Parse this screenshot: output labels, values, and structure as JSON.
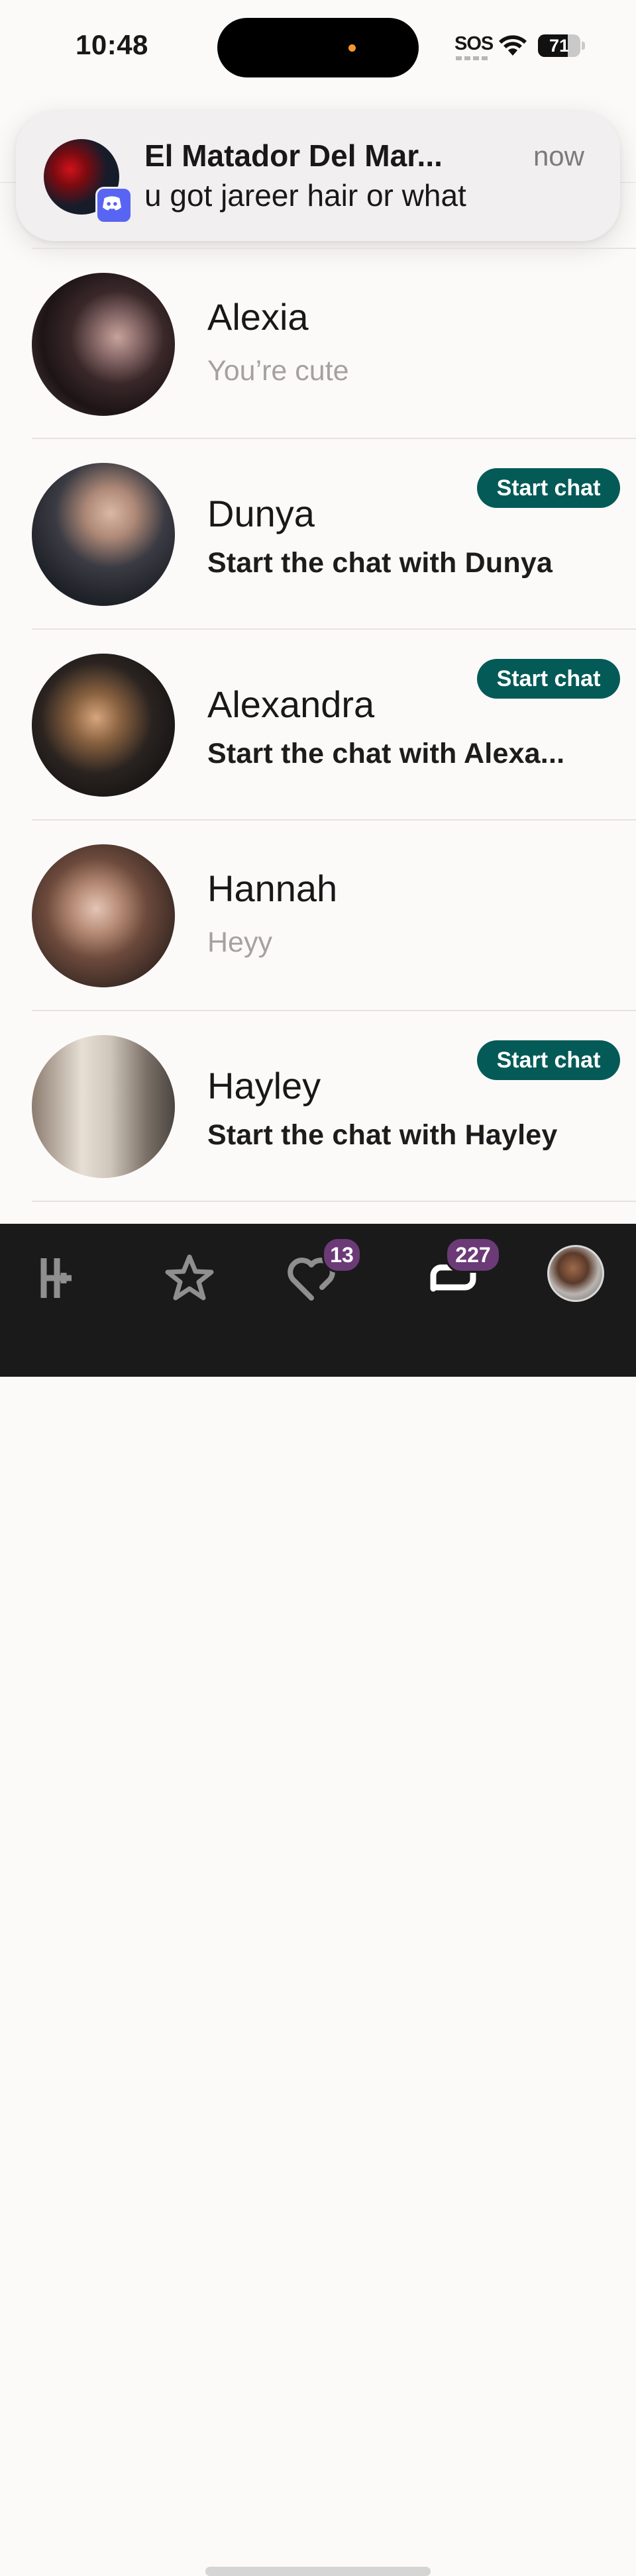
{
  "status_bar": {
    "time": "10:48",
    "sos": "SOS",
    "battery_level": "71",
    "battery_fraction": 0.71
  },
  "notification": {
    "title": "El Matador Del Mar...",
    "time": "now",
    "body": "u got jareer hair or what",
    "app_icon": "discord-icon",
    "app_color": "#5865f2"
  },
  "conversations": [
    {
      "name": "Alexia",
      "message": "You’re cute",
      "has_start_chat": false
    },
    {
      "name": "Dunya",
      "message": "Start the chat with Dunya",
      "has_start_chat": true,
      "start_chat_label": "Start chat"
    },
    {
      "name": "Alexandra",
      "message": "Start the chat with Alexa...",
      "has_start_chat": true,
      "start_chat_label": "Start chat"
    },
    {
      "name": "Hannah",
      "message": "Heyy",
      "has_start_chat": false
    },
    {
      "name": "Hayley",
      "message": "Start the chat with Hayley",
      "has_start_chat": true,
      "start_chat_label": "Start chat"
    }
  ],
  "tab_bar": {
    "items": [
      {
        "icon": "hinge-logo-icon"
      },
      {
        "icon": "star-icon"
      },
      {
        "icon": "likes-heart-icon",
        "badge": "13"
      },
      {
        "icon": "chat-bubbles-icon",
        "badge": "227",
        "active": true
      },
      {
        "icon": "profile-avatar"
      }
    ]
  },
  "colors": {
    "accent": "#045a57",
    "badge": "#6b3a77",
    "tab_bar": "#1a1a1a",
    "background": "#fcfaf9"
  }
}
